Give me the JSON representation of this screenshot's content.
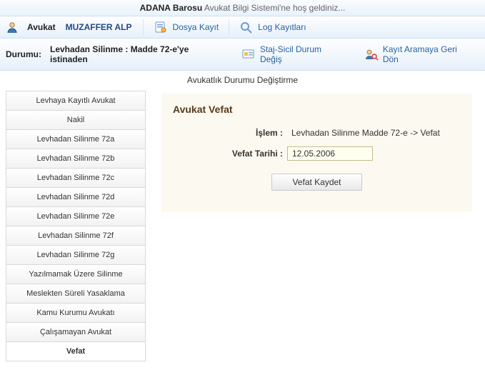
{
  "welcome": {
    "org": "ADANA Barosu",
    "text": " Avukat Bilgi Sistemi'ne hoş geldiniz..."
  },
  "header": {
    "avukat_label": "Avukat",
    "avukat_name": "MUZAFFER ALP",
    "menu": {
      "dosya": "Dosya Kayıt",
      "log": "Log Kayıtları"
    }
  },
  "status": {
    "label": "Durumu:",
    "value": "Levhadan Silinme : Madde 72-e'ye istinaden",
    "stajsicil": "Staj-Sicil Durum Değiş",
    "geri": "Kayıt Aramaya Geri Dön"
  },
  "subheader": "Avukatlık Durumu Değiştirme",
  "sidebar": {
    "items": [
      "Levhaya Kayıtlı Avukat",
      "Nakil",
      "Levhadan Silinme 72a",
      "Levhadan Silinme 72b",
      "Levhadan Silinme 72c",
      "Levhadan Silinme 72d",
      "Levhadan Silinme 72e",
      "Levhadan Silinme 72f",
      "Levhadan Silinme 72g",
      "Yazılmamak Üzere Silinme",
      "Meslekten Süreli Yasaklama",
      "Kamu Kurumu Avukatı",
      "Çalışamayan Avukat",
      "Vefat"
    ],
    "active_index": 13
  },
  "form": {
    "title": "Avukat Vefat",
    "islem_label": "İşlem :",
    "islem_value": "Levhadan Silinme Madde 72-e -> Vefat",
    "tarih_label": "Vefat Tarihi :",
    "tarih_value": "12.05.2006",
    "save_label": "Vefat Kaydet"
  }
}
